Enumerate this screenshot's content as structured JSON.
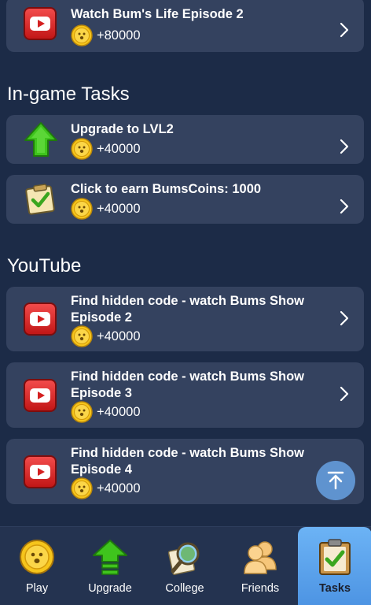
{
  "top_task": {
    "title": "Watch Bum's Life Episode 2",
    "reward": "+80000"
  },
  "sections": {
    "ingame_title": "In-game Tasks",
    "youtube_title": "YouTube"
  },
  "ingame_tasks": [
    {
      "title": "Upgrade to LVL2",
      "reward": "+40000"
    },
    {
      "title": "Click to earn BumsCoins: 1000",
      "reward": "+40000"
    }
  ],
  "youtube_tasks": [
    {
      "title": "Find hidden code - watch Bums Show Episode 2",
      "reward": "+40000"
    },
    {
      "title": "Find hidden code - watch Bums Show Episode 3",
      "reward": "+40000"
    },
    {
      "title": "Find hidden code - watch Bums Show Episode 4",
      "reward": "+40000"
    }
  ],
  "nav": {
    "items": [
      {
        "label": "Play",
        "icon": "coin-icon"
      },
      {
        "label": "Upgrade",
        "icon": "upgrade-arrow-icon"
      },
      {
        "label": "College",
        "icon": "magnifier-icon"
      },
      {
        "label": "Friends",
        "icon": "friends-icon"
      },
      {
        "label": "Tasks",
        "icon": "clipboard-check-icon"
      }
    ],
    "active": "Tasks"
  },
  "colors": {
    "background": "#1c2b47",
    "card": "#34425f",
    "accent": "#5a9ff0",
    "youtube_red": "#d42020",
    "coin": "#f5c518"
  }
}
